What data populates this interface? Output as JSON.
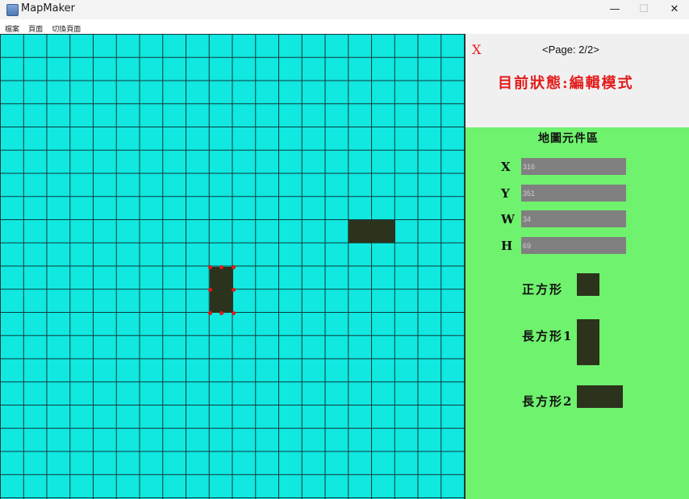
{
  "window": {
    "title": "MapMaker",
    "minimize": "—",
    "maximize": "☐",
    "close": "✕"
  },
  "menu": [
    "檔案",
    "頁面",
    "切換頁面"
  ],
  "header": {
    "close_label": "X",
    "page_indicator": "<Page: 2/2>",
    "status": "目前狀態:編輯模式"
  },
  "panel": {
    "title": "地圖元件區",
    "fields": [
      {
        "label": "X",
        "value": "316"
      },
      {
        "label": "Y",
        "value": "351"
      },
      {
        "label": "W",
        "value": "34"
      },
      {
        "label": "H",
        "value": "69"
      }
    ],
    "palette": {
      "square": "正方形",
      "rect1": "長方形1",
      "rect2": "長方形2"
    }
  },
  "colors": {
    "canvas": "#10e8e0",
    "grid": "#103a3a",
    "block": "#2c331c",
    "handle": "#e21818",
    "panel": "#6ff26e",
    "status": "#e31b1b"
  }
}
